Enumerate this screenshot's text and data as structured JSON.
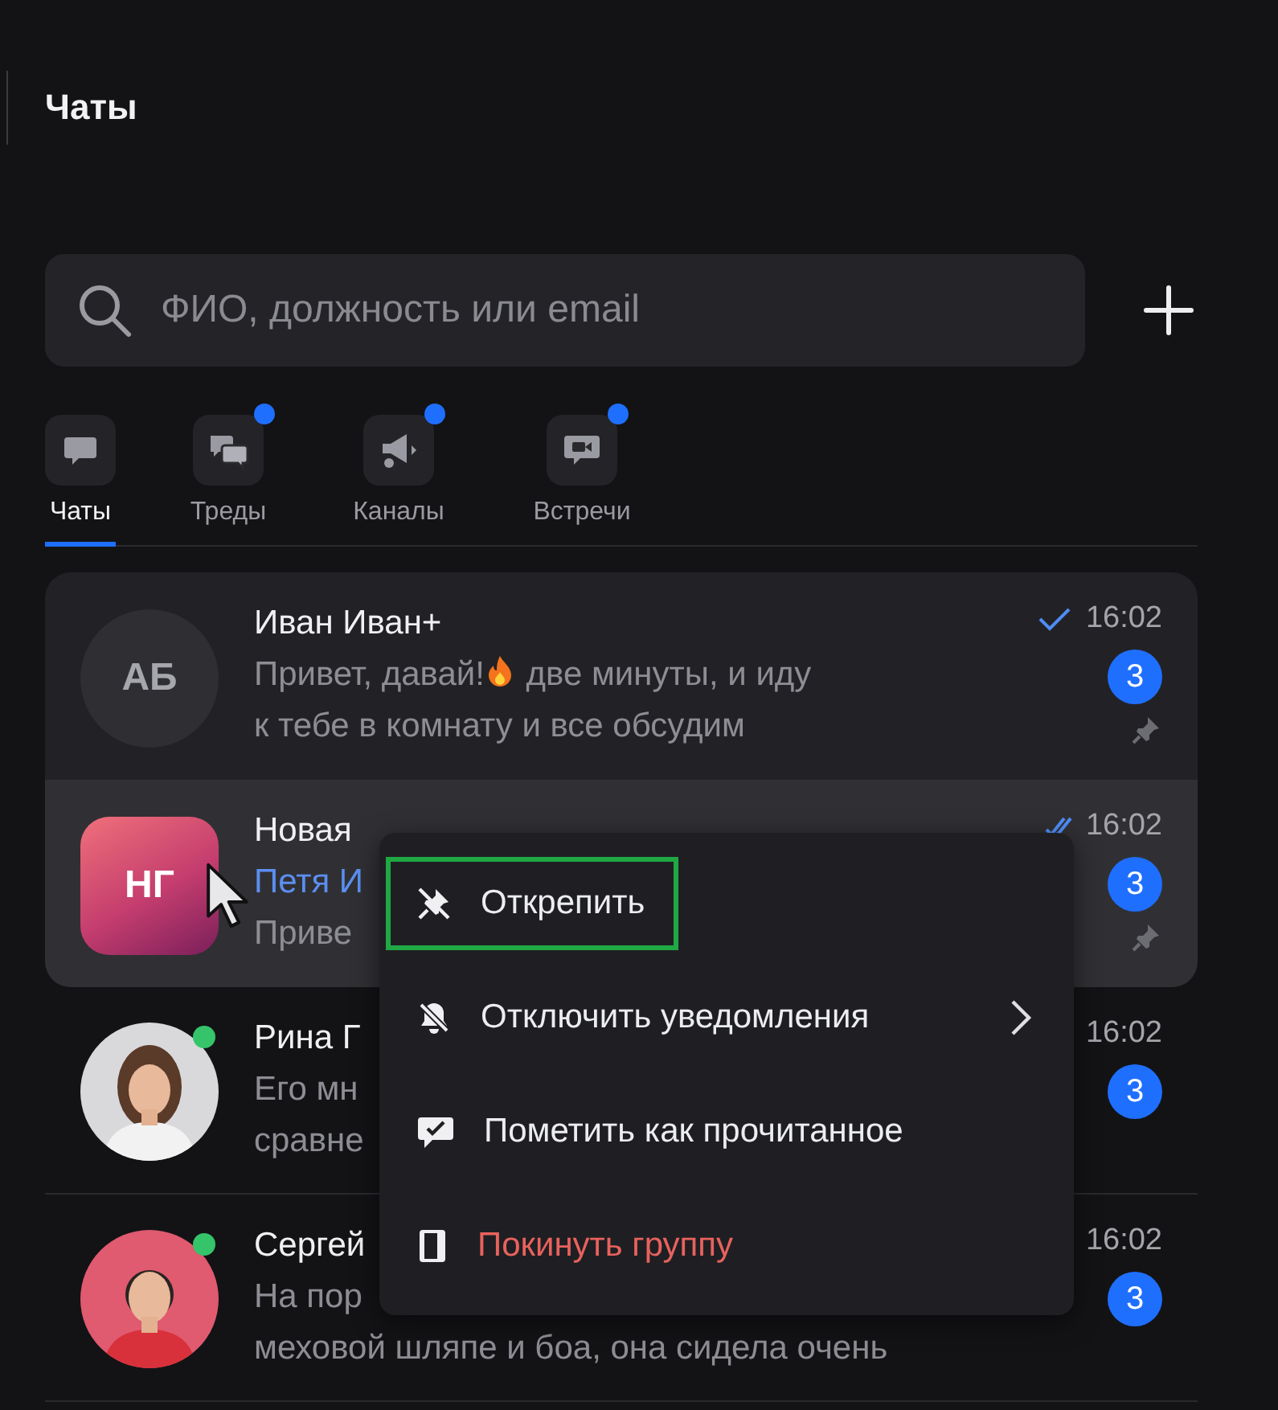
{
  "title": "Чаты",
  "search": {
    "placeholder": "ФИО, должность или email"
  },
  "tabs": [
    {
      "label": "Чаты",
      "selected": true,
      "has_update": false
    },
    {
      "label": "Треды",
      "selected": false,
      "has_update": true
    },
    {
      "label": "Каналы",
      "selected": false,
      "has_update": true
    },
    {
      "label": "Встречи",
      "selected": false,
      "has_update": true
    }
  ],
  "chats": [
    {
      "avatar": {
        "kind": "person",
        "text": "АБ"
      },
      "name": "Иван Иван+",
      "message_lines": [
        [
          {
            "text": "Привет, давай!"
          },
          {
            "kind": "fire"
          },
          {
            "text": " две минуты, и иду"
          }
        ],
        [
          {
            "text": "к тебе в комнату и все обсудим"
          }
        ]
      ],
      "read": false,
      "time": "16:02",
      "unread": "3",
      "pinned": true,
      "hovered": false,
      "online": false
    },
    {
      "avatar": {
        "kind": "group",
        "text": "НГ"
      },
      "name": "Новая",
      "message_lines": [
        [
          {
            "kind": "sender",
            "text": "Петя И"
          }
        ],
        [
          {
            "text": "Приве"
          }
        ]
      ],
      "read": true,
      "time": "16:02",
      "unread": "3",
      "pinned": true,
      "hovered": true,
      "online": false
    },
    {
      "avatar": {
        "kind": "picture"
      },
      "name": "Рина Г",
      "message_lines": [
        [
          {
            "text": "Его мн"
          }
        ],
        [
          {
            "text": "сравне"
          }
        ]
      ],
      "time": "16:02",
      "unread": "3",
      "pinned": false,
      "hovered": false,
      "online": true
    },
    {
      "avatar": {
        "kind": "picture"
      },
      "name": "Сергей",
      "message_lines": [
        [
          {
            "text": "На пор"
          }
        ],
        [
          {
            "text": "меховой шляпе и боа, она сидела очень"
          }
        ]
      ],
      "time": "16:02",
      "unread": "3",
      "pinned": false,
      "hovered": false,
      "online": true
    }
  ],
  "menu": {
    "items": [
      {
        "label": "Открепить",
        "kind": "normal",
        "highlighted": true,
        "submenu": false
      },
      {
        "label": "Отключить уведомления",
        "kind": "normal",
        "highlighted": false,
        "submenu": true
      },
      {
        "label": "Пометить как прочитанное",
        "kind": "normal",
        "highlighted": false,
        "submenu": false
      },
      {
        "label": "Покинуть группу",
        "kind": "danger",
        "highlighted": false,
        "submenu": false
      }
    ]
  }
}
